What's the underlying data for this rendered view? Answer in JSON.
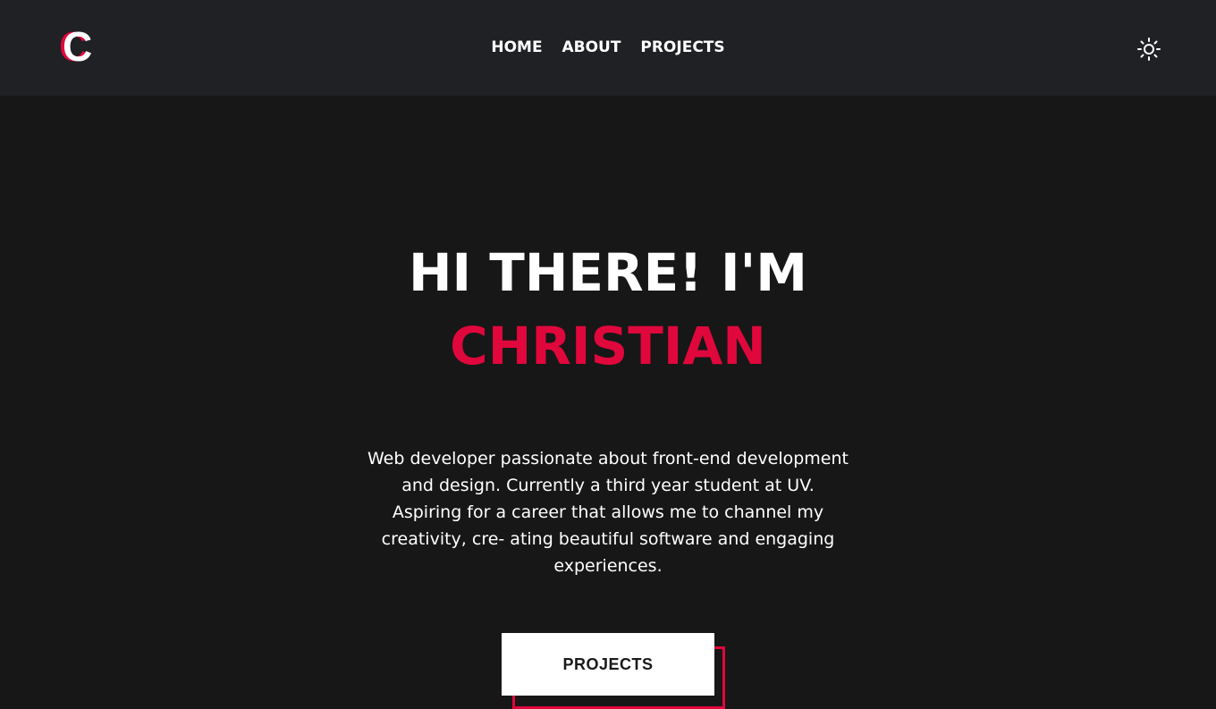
{
  "header": {
    "logo": "C",
    "nav": [
      "HOME",
      "ABOUT",
      "PROJECTS"
    ],
    "theme_icon": "sun-icon"
  },
  "hero": {
    "greeting": "HI THERE! I'M",
    "name": "CHRISTIAN",
    "bio": "Web developer passionate about front-end development and design. Currently a third year student at UV. Aspiring for a career that allows me to channel my creativity, cre- ating beautiful software and engaging experiences.",
    "button": "PROJECTS"
  },
  "colors": {
    "accent": "#e0073c",
    "background": "#171717",
    "header": "#202124"
  }
}
